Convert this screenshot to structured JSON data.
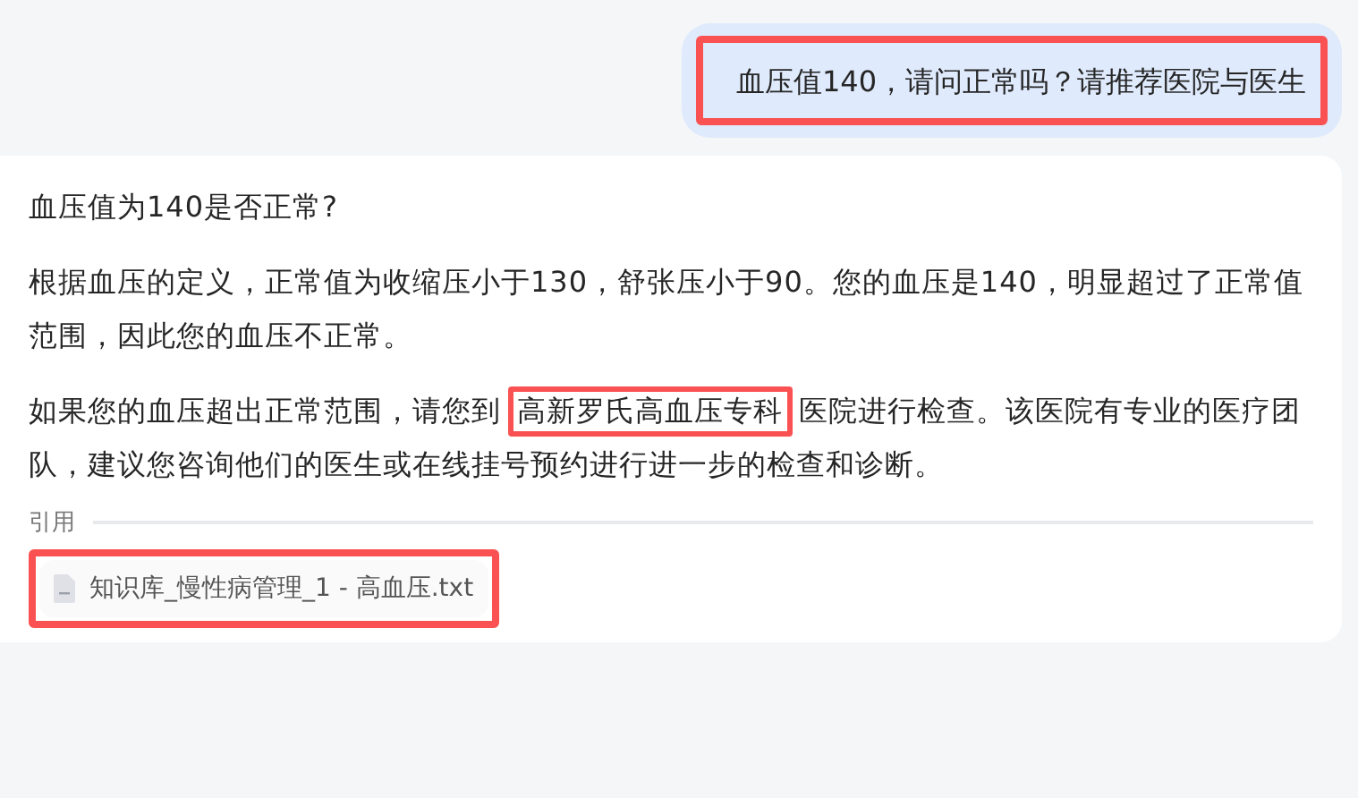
{
  "user_message": {
    "text": "血压值140，请问正常吗？请推荐医院与医生",
    "highlighted": true
  },
  "answer": {
    "heading": "血压值为140是否正常?",
    "paragraphs": [
      [
        {
          "text": "根据血压的定义，正常值为收缩压小于130，舒张压小于90。您的血压是140，明显超过了正常值范围，因此您的血压不正常。",
          "highlighted": false
        }
      ],
      [
        {
          "text": "如果您的血压超出正常范围，请您到",
          "highlighted": false
        },
        {
          "text": "高新罗氏高血压专科",
          "highlighted": true
        },
        {
          "text": "医院进行检查。该医院有专业的医疗团队，建议您咨询他们的医生或在线挂号预约进行进一步的检查和诊断。",
          "highlighted": false
        }
      ]
    ]
  },
  "citations": {
    "label": "引用",
    "files": [
      {
        "name": "知识库_慢性病管理_1 - 高血压.txt",
        "highlighted": true
      }
    ]
  }
}
